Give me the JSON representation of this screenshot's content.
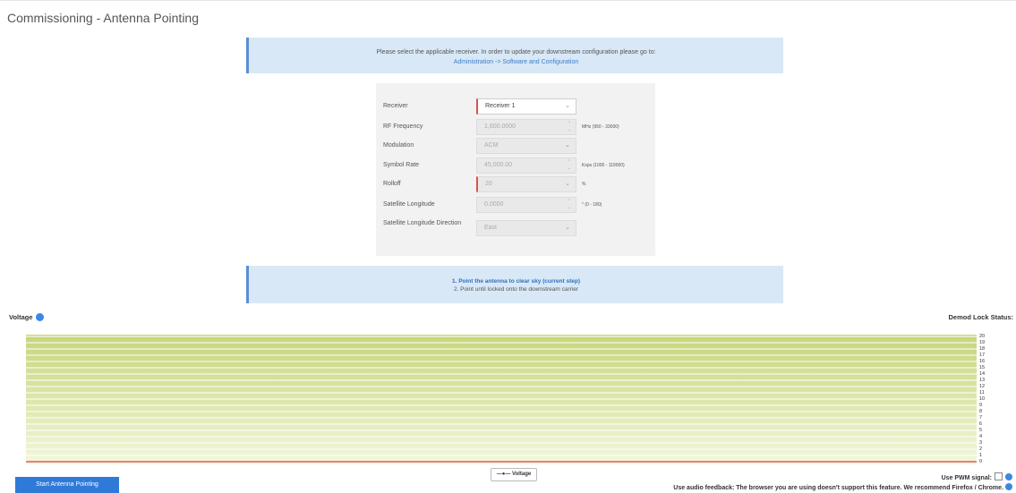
{
  "page": {
    "title": "Commissioning - Antenna Pointing"
  },
  "info": {
    "text": "Please select the applicable receiver. In order to update your downstream configuration please go to:",
    "link": "Administration -> Software and Configuration"
  },
  "form": {
    "receiver": {
      "label": "Receiver",
      "value": "Receiver 1"
    },
    "rf_frequency": {
      "label": "RF Frequency",
      "value": "1,600.0000",
      "unit": "MHz (950 - 33000)"
    },
    "modulation": {
      "label": "Modulation",
      "value": "ACM"
    },
    "symbol_rate": {
      "label": "Symbol Rate",
      "value": "45,000.00",
      "unit": "Ksps (1000 - 119000)"
    },
    "rolloff": {
      "label": "Rolloff",
      "value": "20",
      "unit": "%"
    },
    "sat_longitude": {
      "label": "Satellite Longitude",
      "value": "0.0000",
      "unit": "° (0 - 180)"
    },
    "sat_longitude_dir": {
      "label": "Satellite Longitude Direction",
      "value": "East"
    }
  },
  "steps": {
    "current": "1. Point the antenna to clear sky (current step)",
    "next": "2. Point until locked onto the downstream carrier"
  },
  "voltage_label": "Voltage",
  "demod_label": "Demod Lock Status:",
  "legend_label": "Voltage",
  "start_button": "Start Antenna Pointing",
  "pwm_label": "Use PWM signal:",
  "audio_label": "Use audio feedback: The browser you are using doesn't support this feature. We recommend Firefox / Chrome.",
  "chart_data": {
    "type": "area",
    "series": [
      {
        "name": "Voltage",
        "values": [
          0
        ]
      }
    ],
    "ylim": [
      0,
      20
    ],
    "yticks": [
      "0",
      "1",
      "2",
      "3",
      "4",
      "5",
      "6",
      "7",
      "8",
      "9",
      "10",
      "11",
      "12",
      "13",
      "14",
      "15",
      "16",
      "17",
      "18",
      "19",
      "20"
    ],
    "colors": {
      "top": "#c6d67a",
      "bottom": "#f3f7dc",
      "line": "#e0595e",
      "grid": "#ffffff"
    }
  }
}
